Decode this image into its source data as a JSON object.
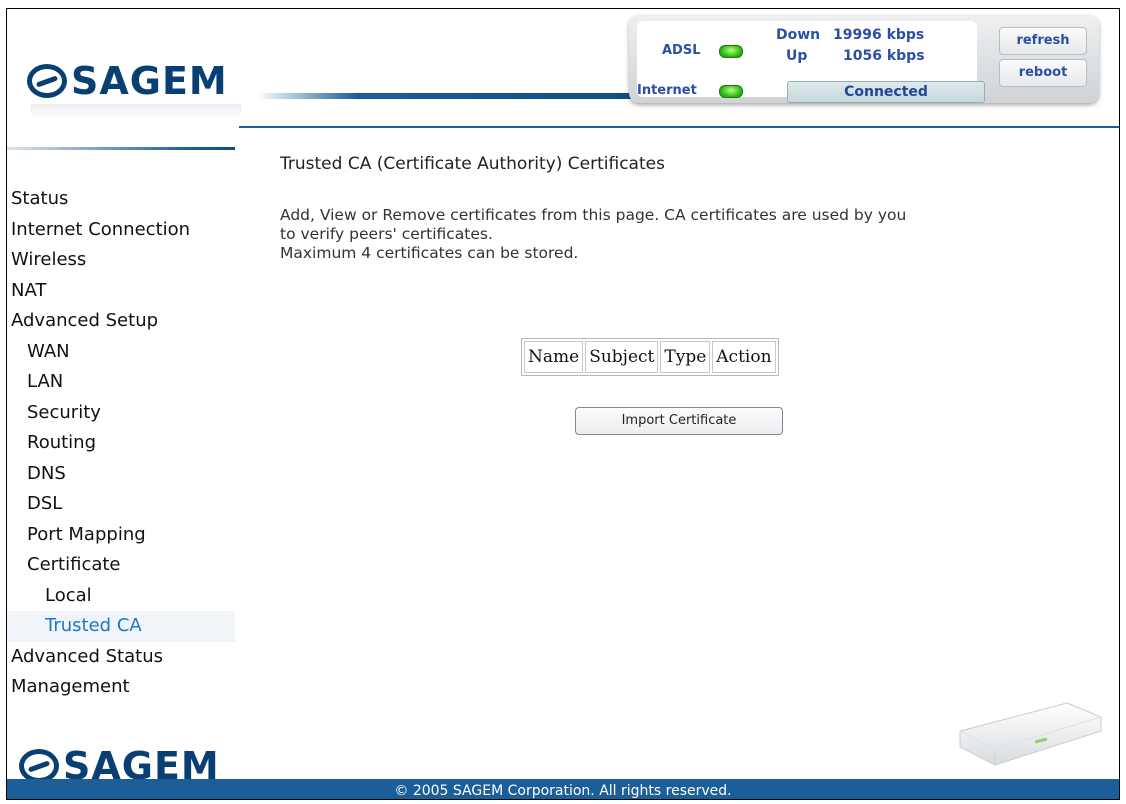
{
  "brand": {
    "name": "SAGEM"
  },
  "status": {
    "adsl_label": "ADSL",
    "internet_label": "Internet",
    "down_label": "Down",
    "up_label": "Up",
    "down_rate": "19996 kbps",
    "up_rate": "1056 kbps",
    "connection_state": "Connected",
    "refresh_label": "refresh",
    "reboot_label": "reboot",
    "led_color": "#22b10d"
  },
  "nav": {
    "items": [
      {
        "label": "Status"
      },
      {
        "label": "Internet Connection"
      },
      {
        "label": "Wireless"
      },
      {
        "label": "NAT"
      },
      {
        "label": "Advanced Setup"
      },
      {
        "label": "WAN"
      },
      {
        "label": "LAN"
      },
      {
        "label": "Security"
      },
      {
        "label": "Routing"
      },
      {
        "label": "DNS"
      },
      {
        "label": "DSL"
      },
      {
        "label": "Port Mapping"
      },
      {
        "label": "Certificate"
      },
      {
        "label": "Local"
      },
      {
        "label": "Trusted CA"
      },
      {
        "label": "Advanced Status"
      },
      {
        "label": "Management"
      }
    ],
    "active_color": "#1a76d2"
  },
  "main": {
    "title": "Trusted CA (Certificate Authority) Certificates",
    "desc_line1": "Add, View or Remove certificates from this page. CA certificates are used by you",
    "desc_line2": "to verify peers' certificates.",
    "desc_line3": "Maximum 4 certificates can be stored.",
    "table_headers": [
      "Name",
      "Subject",
      "Type",
      "Action"
    ],
    "import_button": "Import Certificate"
  },
  "footer": {
    "text": "© 2005 SAGEM Corporation. All rights reserved."
  }
}
